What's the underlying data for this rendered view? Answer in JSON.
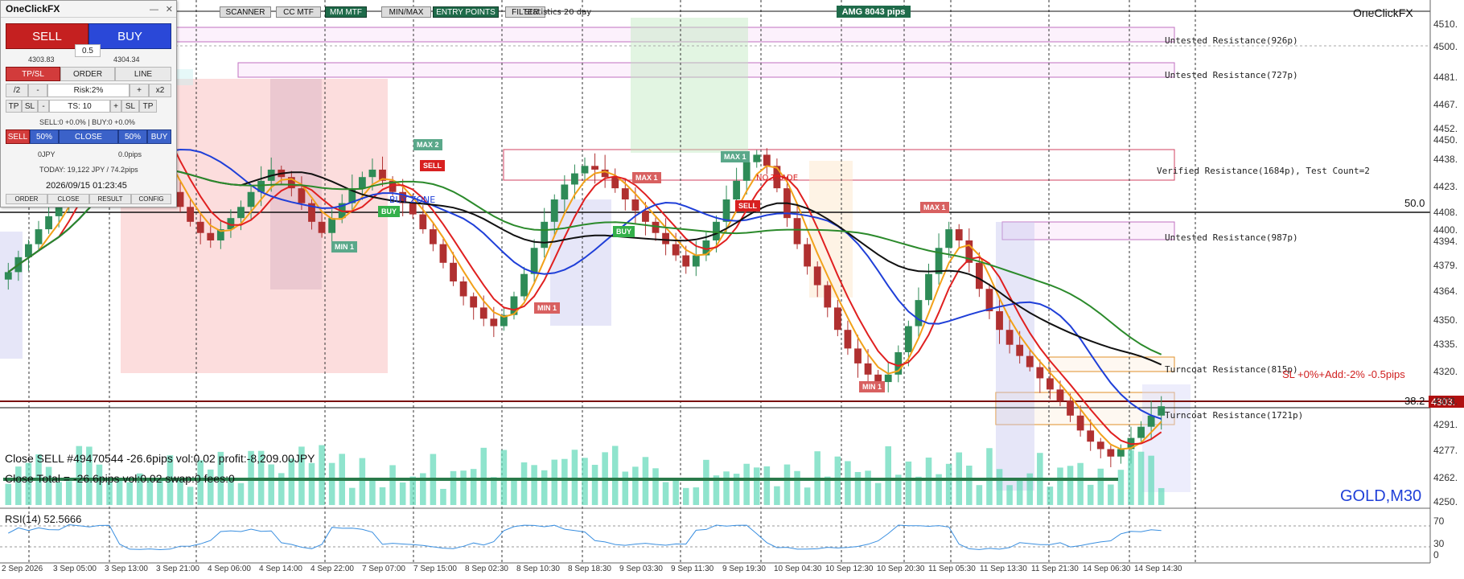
{
  "panel": {
    "title": "OneClickFX",
    "sell_label": "SELL",
    "buy_label": "BUY",
    "lot": "0.5",
    "sell_price": "4303.83",
    "buy_price": "4304.34",
    "tpsl_label": "TP/SL",
    "order_label": "ORDER",
    "line_label": "LINE",
    "half_label": "/2",
    "minus_label": "-",
    "risk_label": "Risk:2%",
    "plus_label": "+",
    "x2_label": "x2",
    "tp_label": "TP",
    "sl_label": "SL",
    "ts_label": "TS: 10",
    "positions_text": "SELL:0 +0.0% | BUY:0 +0.0%",
    "close_sell": "SELL",
    "pct50_a": "50%",
    "close_label": "CLOSE",
    "pct50_b": "50%",
    "close_buy": "BUY",
    "pnl_jpy": "0JPY",
    "pnl_pips": "0.0pips",
    "today": "TODAY: 19,122 JPY / 74.2pips",
    "datetime": "2026/09/15  01:23:45",
    "tab_order": "ORDER",
    "tab_close": "CLOSE",
    "tab_result": "RESULT",
    "tab_config": "CONFIG"
  },
  "toolbar": {
    "scanner": "SCANNER",
    "cc_mtf": "CC MTF",
    "mm_mtf": "MM MTF",
    "minmax": "MIN/MAX",
    "entry_points": "ENTRY POINTS",
    "filter": "FILTER",
    "stats": "Statistics 20 day",
    "amg": "AMG   8043 pips",
    "brand_right": "OneClickFX"
  },
  "zones": {
    "z1": "Untested Resistance(926p)",
    "z2": "Untested Resistance(727p)",
    "z3": "Verified Resistance(1684p), Test Count=2",
    "z4": "Untested Resistance(987p)",
    "z5": "Turncoat Resistance(815p)",
    "z6": "Turncoat Resistance(1721p)"
  },
  "overlay": {
    "close_sell": "Close SELL #49470544 -26.6pips vol:0.02 profit:-8,209.00JPY",
    "close_total": "Close Total = -26.6pips vol:0.02 swap:0 fees:0",
    "sl_info": "SL +0%+Add:-2% -0.5pips",
    "symbol": "GOLD,M30",
    "fib_50": "50.0",
    "fib_382": "38.2",
    "rsi": "RSI(14) 52.5666"
  },
  "signals": {
    "buy": "BUY",
    "sell": "SELL",
    "max1": "MAX 1",
    "max2": "MAX 2",
    "min1": "MIN 1",
    "no_trade": "NO TRADE",
    "buy_zone": "BUY ZONE"
  },
  "price_axis": {
    "ticks": [
      "4510.",
      "4500.",
      "4481.",
      "4467.",
      "4452.",
      "4450.",
      "4438.",
      "4423.",
      "4408.",
      "4400.",
      "4394.",
      "4379.",
      "4364.",
      "4350.",
      "4335.",
      "4320.",
      "4303.",
      "4291.",
      "4277.",
      "4262.",
      "4250."
    ],
    "current_price": "4303."
  },
  "rsi_axis": [
    "70",
    "30",
    "0"
  ],
  "time_axis": [
    "2 Sep 2026",
    "3 Sep 05:00",
    "3 Sep 13:00",
    "3 Sep 21:00",
    "4 Sep 06:00",
    "4 Sep 14:00",
    "4 Sep 22:00",
    "7 Sep 07:00",
    "7 Sep 15:00",
    "8 Sep 02:30",
    "8 Sep 10:30",
    "8 Sep 18:30",
    "9 Sep 03:30",
    "9 Sep 11:30",
    "9 Sep 19:30",
    "10 Sep 04:30",
    "10 Sep 12:30",
    "10 Sep 20:30",
    "11 Sep 05:30",
    "11 Sep 13:30",
    "11 Sep 21:30",
    "14 Sep 06:30",
    "14 Sep 14:30"
  ],
  "colors": {
    "bull": "#2e8b57",
    "bear": "#b03030",
    "ma_red": "#e02020",
    "ma_blue": "#1f3fd8",
    "ma_black": "#111111",
    "ma_green": "#2b8a2b",
    "ma_orange": "#f2a11a",
    "volume": "#5fd8b8",
    "rsi": "#3a8fe0"
  },
  "chart_data": {
    "type": "candlestick",
    "symbol": "GOLD",
    "timeframe": "M30",
    "price_range": [
      4250,
      4515
    ],
    "current_price": 4303.8,
    "close_prices": [
      4375,
      4383,
      4390,
      4398,
      4405,
      4412,
      4425,
      4440,
      4456,
      4470,
      4480,
      4475,
      4462,
      4450,
      4440,
      4428,
      4418,
      4410,
      4402,
      4396,
      4392,
      4398,
      4404,
      4410,
      4418,
      4424,
      4430,
      4426,
      4420,
      4412,
      4402,
      4396,
      4404,
      4412,
      4420,
      4426,
      4430,
      4424,
      4418,
      4412,
      4406,
      4398,
      4390,
      4380,
      4370,
      4362,
      4356,
      4350,
      4346,
      4352,
      4362,
      4374,
      4388,
      4402,
      4414,
      4422,
      4428,
      4432,
      4430,
      4426,
      4420,
      4414,
      4408,
      4402,
      4396,
      4390,
      4384,
      4378,
      4384,
      4392,
      4402,
      4414,
      4424,
      4434,
      4438,
      4432,
      4420,
      4404,
      4390,
      4378,
      4368,
      4356,
      4344,
      4334,
      4326,
      4320,
      4316,
      4320,
      4332,
      4346,
      4360,
      4374,
      4388,
      4398,
      4392,
      4380,
      4366,
      4354,
      4344,
      4336,
      4330,
      4324,
      4318,
      4312,
      4306,
      4298,
      4290,
      4284,
      4280,
      4276,
      4280,
      4286,
      4292,
      4298,
      4303
    ],
    "rsi_value": 52.5666
  }
}
